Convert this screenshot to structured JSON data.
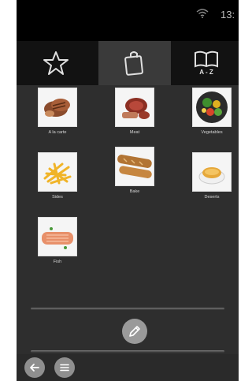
{
  "status_bar": {
    "time": "13:"
  },
  "tabs": [
    {
      "name": "favorites",
      "icon": "star-icon",
      "active": false
    },
    {
      "name": "categories",
      "icon": "shopping-bag-icon",
      "active": true
    },
    {
      "name": "a-z",
      "icon": "book-a-z-icon",
      "label": "A - Z",
      "active": false
    }
  ],
  "categories": [
    {
      "label": "A la carte",
      "icon": "steak-icon"
    },
    {
      "label": "Meat",
      "icon": "meat-icon"
    },
    {
      "label": "Vegetables",
      "icon": "vegetables-icon"
    },
    {
      "label": "Sides",
      "icon": "fries-icon"
    },
    {
      "label": "Bake",
      "icon": "bread-icon"
    },
    {
      "label": "Deserts",
      "icon": "dessert-icon"
    },
    {
      "label": "Fish",
      "icon": "fish-icon"
    }
  ]
}
